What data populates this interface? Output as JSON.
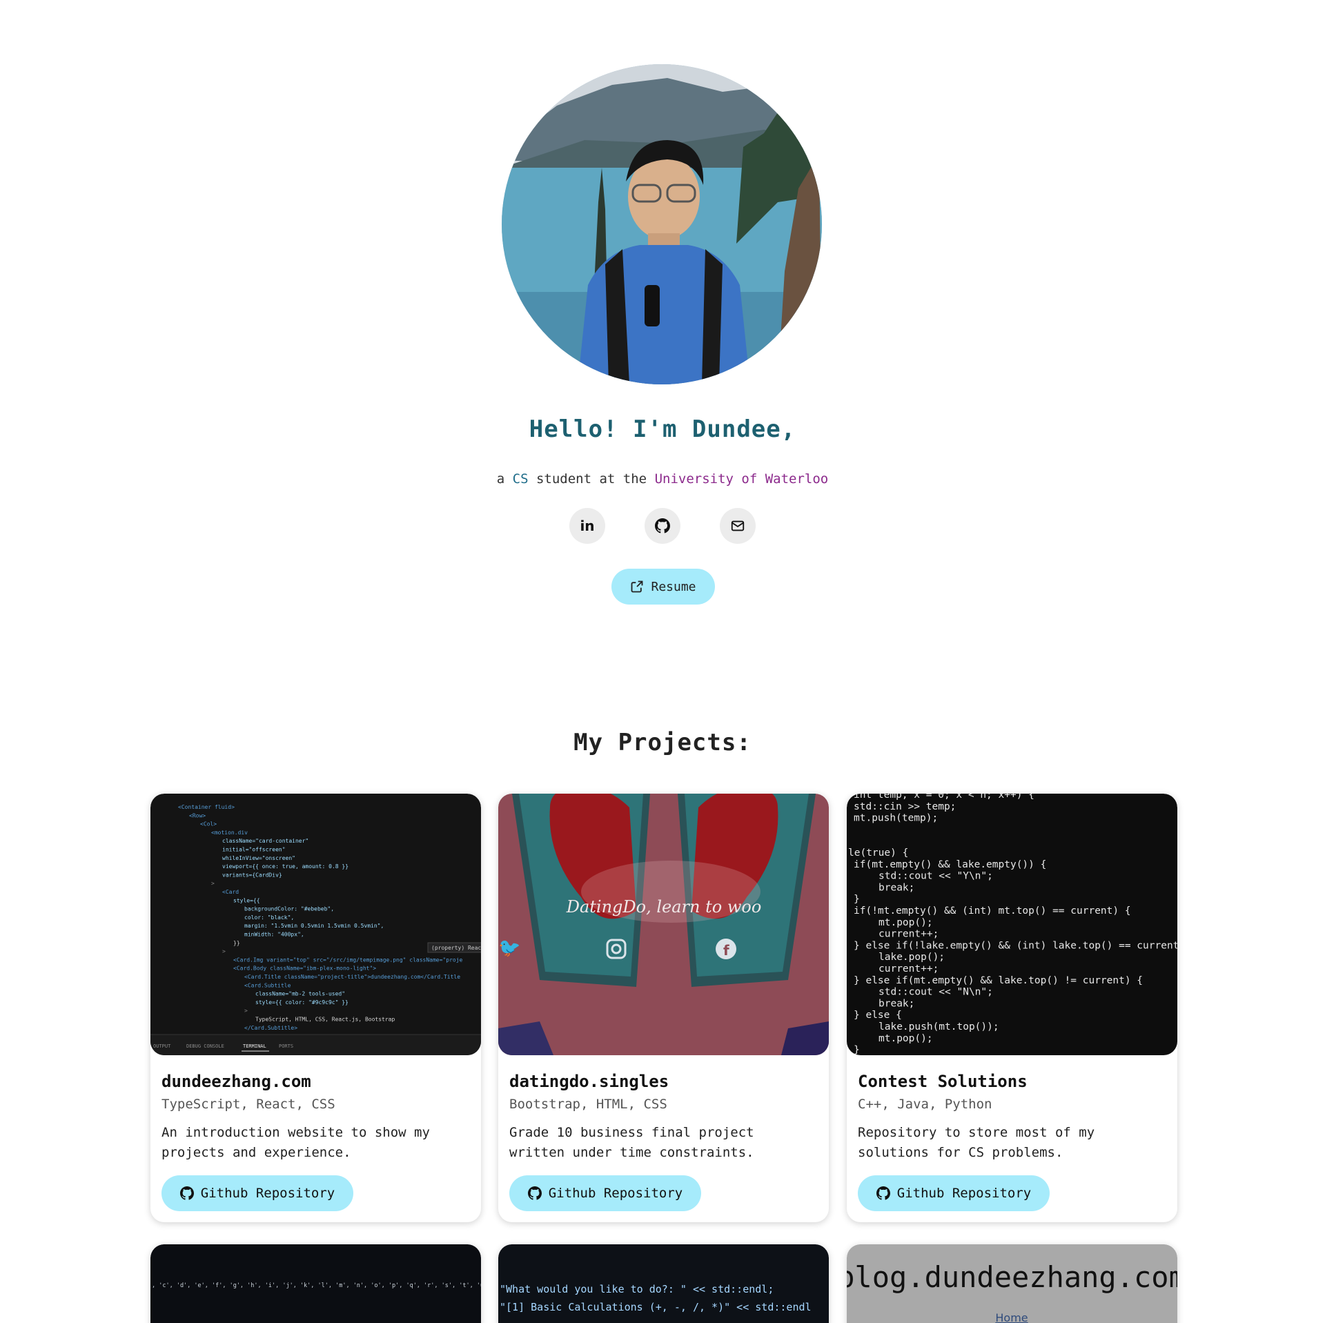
{
  "hero": {
    "greeting": "Hello! I'm Dundee,",
    "tagline_prefix": "a ",
    "tagline_cs": "CS",
    "tagline_mid": " student at the ",
    "tagline_uni": "University of Waterloo",
    "socials": [
      {
        "name": "linkedin",
        "icon": "linkedin-icon",
        "label": "in"
      },
      {
        "name": "github",
        "icon": "github-icon"
      },
      {
        "name": "email",
        "icon": "mail-icon"
      }
    ],
    "resume_label": "Resume"
  },
  "projects": {
    "title": "My Projects:",
    "button_label": "Github Repository",
    "items": [
      {
        "title": "dundeezhang.com",
        "tools": "TypeScript, React, CSS",
        "description": "An introduction website to show my projects and experience."
      },
      {
        "title": "datingdo.singles",
        "tools": "Bootstrap, HTML, CSS",
        "description": "Grade 10 business final project written under time constraints.",
        "thumb_text": "DatingDo, learn to woo"
      },
      {
        "title": "Contest Solutions",
        "tools": "C++, Java, Python",
        "description": "Repository to store most of my solutions for CS problems."
      }
    ],
    "row2": [
      {
        "thumb_line1": ", 'c', 'd', 'e', 'f', 'g', 'h', 'i', 'j', 'k', 'l', 'm', 'n', 'o', 'p', 'q', 'r', 's', 't', 'u', 'v', 'w',"
      },
      {
        "thumb_line1": "\"What would you like to do?: \" << std::endl;",
        "thumb_line2": "\"[1] Basic Calculations (+, -, /, *)\" << std::endl"
      },
      {
        "thumb_title": "blog.dundeezhang.com",
        "thumb_link": "Home"
      }
    ]
  },
  "code_snippets": {
    "card1": [
      "<Container fluid>",
      "<Row>",
      "<Col>",
      "<motion.div",
      "className=\"card-container\"",
      "initial=\"offscreen\"",
      "whileInView=\"onscreen\"",
      "viewport={{ once: true, amount: 0.8 }}",
      "variants={CardDiv}",
      ">",
      "<Card",
      "style={{",
      "backgroundColor: \"#ebebeb\",",
      "color: \"black\",",
      "margin: \"1.5vmin 0.5vmin 1.5vmin 0.5vmin\",",
      "minWidth: \"400px\",",
      "}}",
      ">",
      "<Card.Img variant=\"top\" src=\"/src/img/tempimage.png\" className=\"proje",
      "<Card.Body className=\"ibm-plex-mono-light\">",
      "<Card.Title className=\"project-title\">dundeezhang.com</Card.Title",
      "<Card.Subtitle",
      "className=\"mb-2 tools-used\"",
      "style={{ color: \"#9c9c9c\" }}",
      ">",
      "TypeScript, HTML, CSS, React.js, Bootstrap",
      "</Card.Subtitle>"
    ],
    "card1_tabs": [
      "OUTPUT",
      "DEBUG CONSOLE",
      "TERMINAL",
      "PORTS"
    ],
    "card1_tooltip": "(property) Reac",
    "card3": [
      "int temp, x = 0; x < n; x++) {",
      "std::cin >> temp;",
      "mt.push(temp);",
      "",
      "",
      "le(true) {",
      "if(mt.empty() && lake.empty()) {",
      "std::cout << \"Y\\n\";",
      "break;",
      "}",
      "if(!mt.empty() && (int) mt.top() == current) {",
      "mt.pop();",
      "current++;",
      "} else if(!lake.empty() && (int) lake.top() == current",
      "lake.pop();",
      "current++;",
      "} else if(mt.empty() && lake.top() != current) {",
      "std::cout << \"N\\n\";",
      "break;",
      "} else {",
      "lake.push(mt.top());",
      "mt.pop();",
      "}"
    ]
  },
  "colors": {
    "accent_button": "#a6ebfb",
    "greeting": "#1d6070",
    "uni": "#8c2a8c",
    "cs": "#1f6d8a"
  }
}
